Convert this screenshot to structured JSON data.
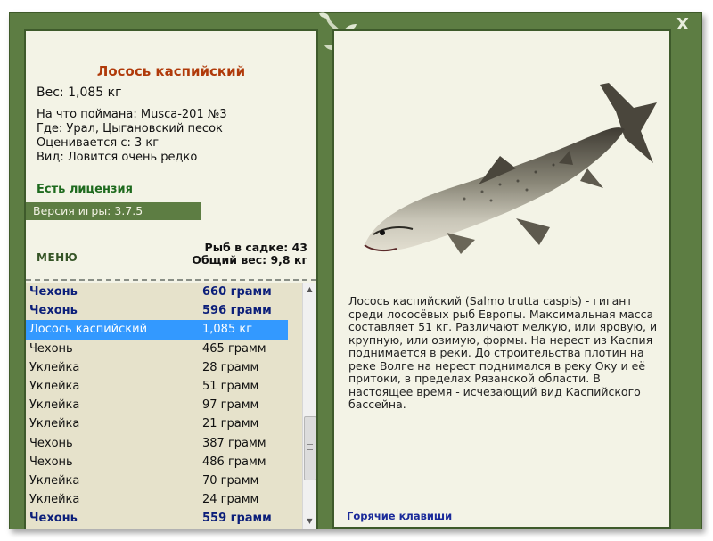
{
  "window": {
    "close_label": "X"
  },
  "fish": {
    "title": "Лосось каспийский",
    "weight": "Вес: 1,085 кг",
    "bait": "На что поймана: Musca-201 №3",
    "where": "Где: Урал, Цыгановский песок",
    "rated_from": "Оценивается с: 3 кг",
    "view": "Вид: Ловится очень редко"
  },
  "license": "Есть лицензия",
  "version": "Версия игры: 3.7.5",
  "menu_label": "МЕНЮ",
  "stats": {
    "fish_in_cage": "Рыб в садке: 43",
    "total_weight": "Общий вес: 9,8 кг"
  },
  "catch_list": [
    {
      "name": "Чехонь",
      "value": "660 грамм",
      "bold": true
    },
    {
      "name": "Чехонь",
      "value": "596 грамм",
      "bold": true
    },
    {
      "name": "Лосось каспийский",
      "value": "1,085 кг",
      "selected": true
    },
    {
      "name": "Чехонь",
      "value": "465 грамм"
    },
    {
      "name": "Уклейка",
      "value": "28 грамм"
    },
    {
      "name": "Уклейка",
      "value": "51 грамм"
    },
    {
      "name": "Уклейка",
      "value": "97 грамм"
    },
    {
      "name": "Уклейка",
      "value": "21 грамм"
    },
    {
      "name": "Чехонь",
      "value": "387 грамм"
    },
    {
      "name": "Чехонь",
      "value": "486 грамм"
    },
    {
      "name": "Уклейка",
      "value": "70 грамм"
    },
    {
      "name": "Уклейка",
      "value": "24 грамм"
    },
    {
      "name": "Чехонь",
      "value": "559 грамм",
      "bold": true
    }
  ],
  "description": "Лосось каспийский (Salmo trutta caspis) - гигант среди лососёвых рыб Европы. Максимальная масса составляет 51 кг. Различают мелкую, или яровую, и крупную, или озимую, формы. На нерест из Каспия поднимается в реки. До строительства плотин на реке Волге на нерест поднимался в реку Оку и её притоки, в пределах Рязанской области. В настоящее время - исчезающий вид Каспийского бассейна.",
  "hotkeys_label": "Горячие клавиши",
  "colors": {
    "frame": "#5d7d43",
    "panel": "#f3f3e6",
    "title": "#b03a0a",
    "list_bg": "#e6e2cb",
    "selection": "#3399ff",
    "bold_row": "#0c1f7a"
  }
}
